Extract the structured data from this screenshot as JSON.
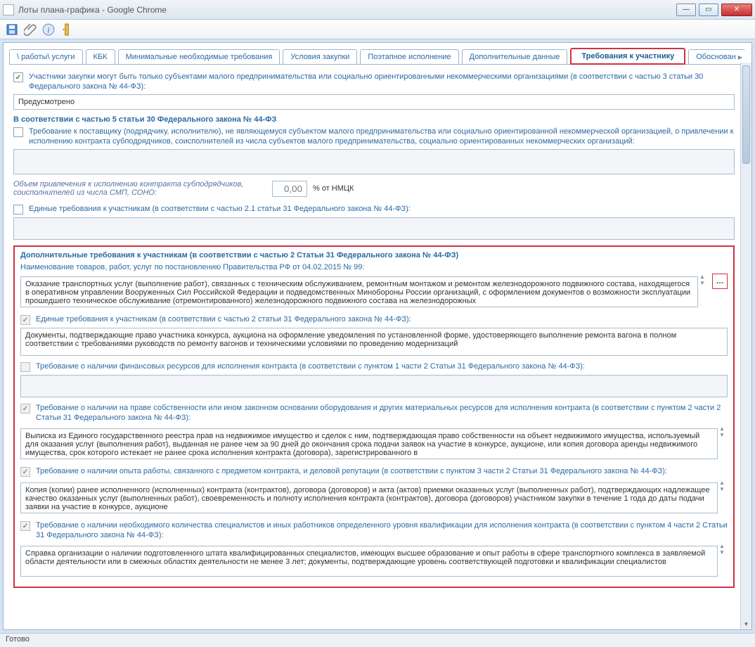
{
  "window_title": "Лоты плана-графика - Google Chrome",
  "tabs": [
    "\\ работы\\ услуги",
    "КБК",
    "Минимальные необходимые требования",
    "Условия закупки",
    "Поэтапное исполнение",
    "Дополнительные данные",
    "Требования к участнику",
    "Обоснован"
  ],
  "active_tab_index": 6,
  "smp": {
    "checkbox_label": "Участники закупки могут быть только субъектами малого предпринимательства или социально ориентированными некоммерческими организациями (в соответствии с частью 3 статьи 30 Федерального закона № 44-ФЗ):",
    "value": "Предусмотрено"
  },
  "section30": {
    "title": "В соответствии с частью 5 статьи 30 Федерального закона № 44-ФЗ",
    "supplier_req_label": "Требование к поставщику (подрядчику, исполнителю), не являющемуся субъектом малого предпринимательства или социально ориентированной некоммерческой организацией, о привлечении к исполнению контракта субподрядчиков, соисполнителей из числа субъектов малого предпринимательства, социально ориентированных некоммерческих организаций:",
    "percent_label": "Объем привлечения к исполнению контракта субподрядчиков, соисполнителей из числа СМП, СОНО:",
    "percent_value": "0,00",
    "percent_suffix": "% от НМЦК"
  },
  "uniform_req": {
    "label": "Единые требования к участникам (в соответствии с частью 2.1 статьи 31 Федерального закона № 44-ФЗ):"
  },
  "additional": {
    "title": "Дополнительные требования к участникам (в соответствии с частью 2 Статьи 31 Федерального закона № 44-ФЗ)",
    "naming_label": "Наименование товаров, работ, услуг по постановлению Правительства РФ от 04.02.2015 № 99:",
    "naming_value": "Оказание транспортных услуг (выполнение работ), связанных с техническим обслуживанием, ремонтным монтажом и ремонтом железнодорожного подвижного состава, находящегося в оперативном управлении Вооруженных Сил Российской Федерации и подведомственных Минобороны России организаций, с оформлением документов о возможности эксплуатации прошедшего техническое обслуживание (отремонтированного) железнодорожного подвижного состава на железнодорожных",
    "uniform2_label": "Единые требования к участникам (в соответствии с частью 2 статьи 31 Федерального закона № 44-ФЗ):",
    "uniform2_value": "Документы, подтверждающие право участника конкурса, аукциона на оформление уведомления по установленной форме, удостоверяющего выполнение ремонта вагона в полном соответствии с требованиями руководств по ремонту вагонов и техническими условиями по проведению модернизаций",
    "fin_label": "Требование о наличии финансовых ресурсов для исполнения контракта (в соответствии с пунктом 1 части 2 Статьи 31 Федерального закона № 44-ФЗ):",
    "own_label": "Требование о наличии на праве собственности или ином законном основании оборудования и других материальных ресурсов для исполнения контракта (в соответствии с пунктом 2 части 2 Статьи 31 Федерального закона № 44-ФЗ):",
    "own_value": "Выписка из Единого государственного реестра прав на недвижимое имущество и сделок с ним, подтверждающая право собственности на объект недвижимого имущества, используемый для оказания услуг (выполнения работ), выданная не ранее чем за 90 дней до окончания срока подачи заявок на участие в конкурсе, аукционе, или копия договора аренды недвижимого имущества, срок которого истекает не ранее срока исполнения контракта (договора), зарегистрированного в",
    "exp_label": "Требование о наличии опыта работы, связанного с предметом контракта, и деловой репутации (в соответствии с пунктом 3 части 2 Статьи 31 Федерального закона № 44-ФЗ):",
    "exp_value": "Копия (копии) ранее исполненного (исполненных) контракта (контрактов), договора (договоров) и акта (актов) приемки оказанных услуг (выполненных работ), подтверждающих надлежащее качество оказанных услуг (выполненных работ), своевременность и полноту исполнения контракта (контрактов), договора (договоров) участником закупки в течение 1 года до даты подачи заявки на участие в конкурсе, аукционе",
    "spec_label": "Требование о наличии необходимого количества специалистов и иных работников определенного уровня квалификации для исполнения контракта (в соответствии с пунктом 4 части 2 Статьи 31 Федерального закона № 44-ФЗ):",
    "spec_value": "Справка организации о наличии подготовленного штата квалифицированных специалистов, имеющих высшее образование и опыт работы в сфере транспортного комплекса в заявляемой области деятельности или в смежных областях деятельности не менее 3 лет; документы, подтверждающие уровень соответствующей подготовки и квалификации специалистов"
  },
  "status": "Готово"
}
